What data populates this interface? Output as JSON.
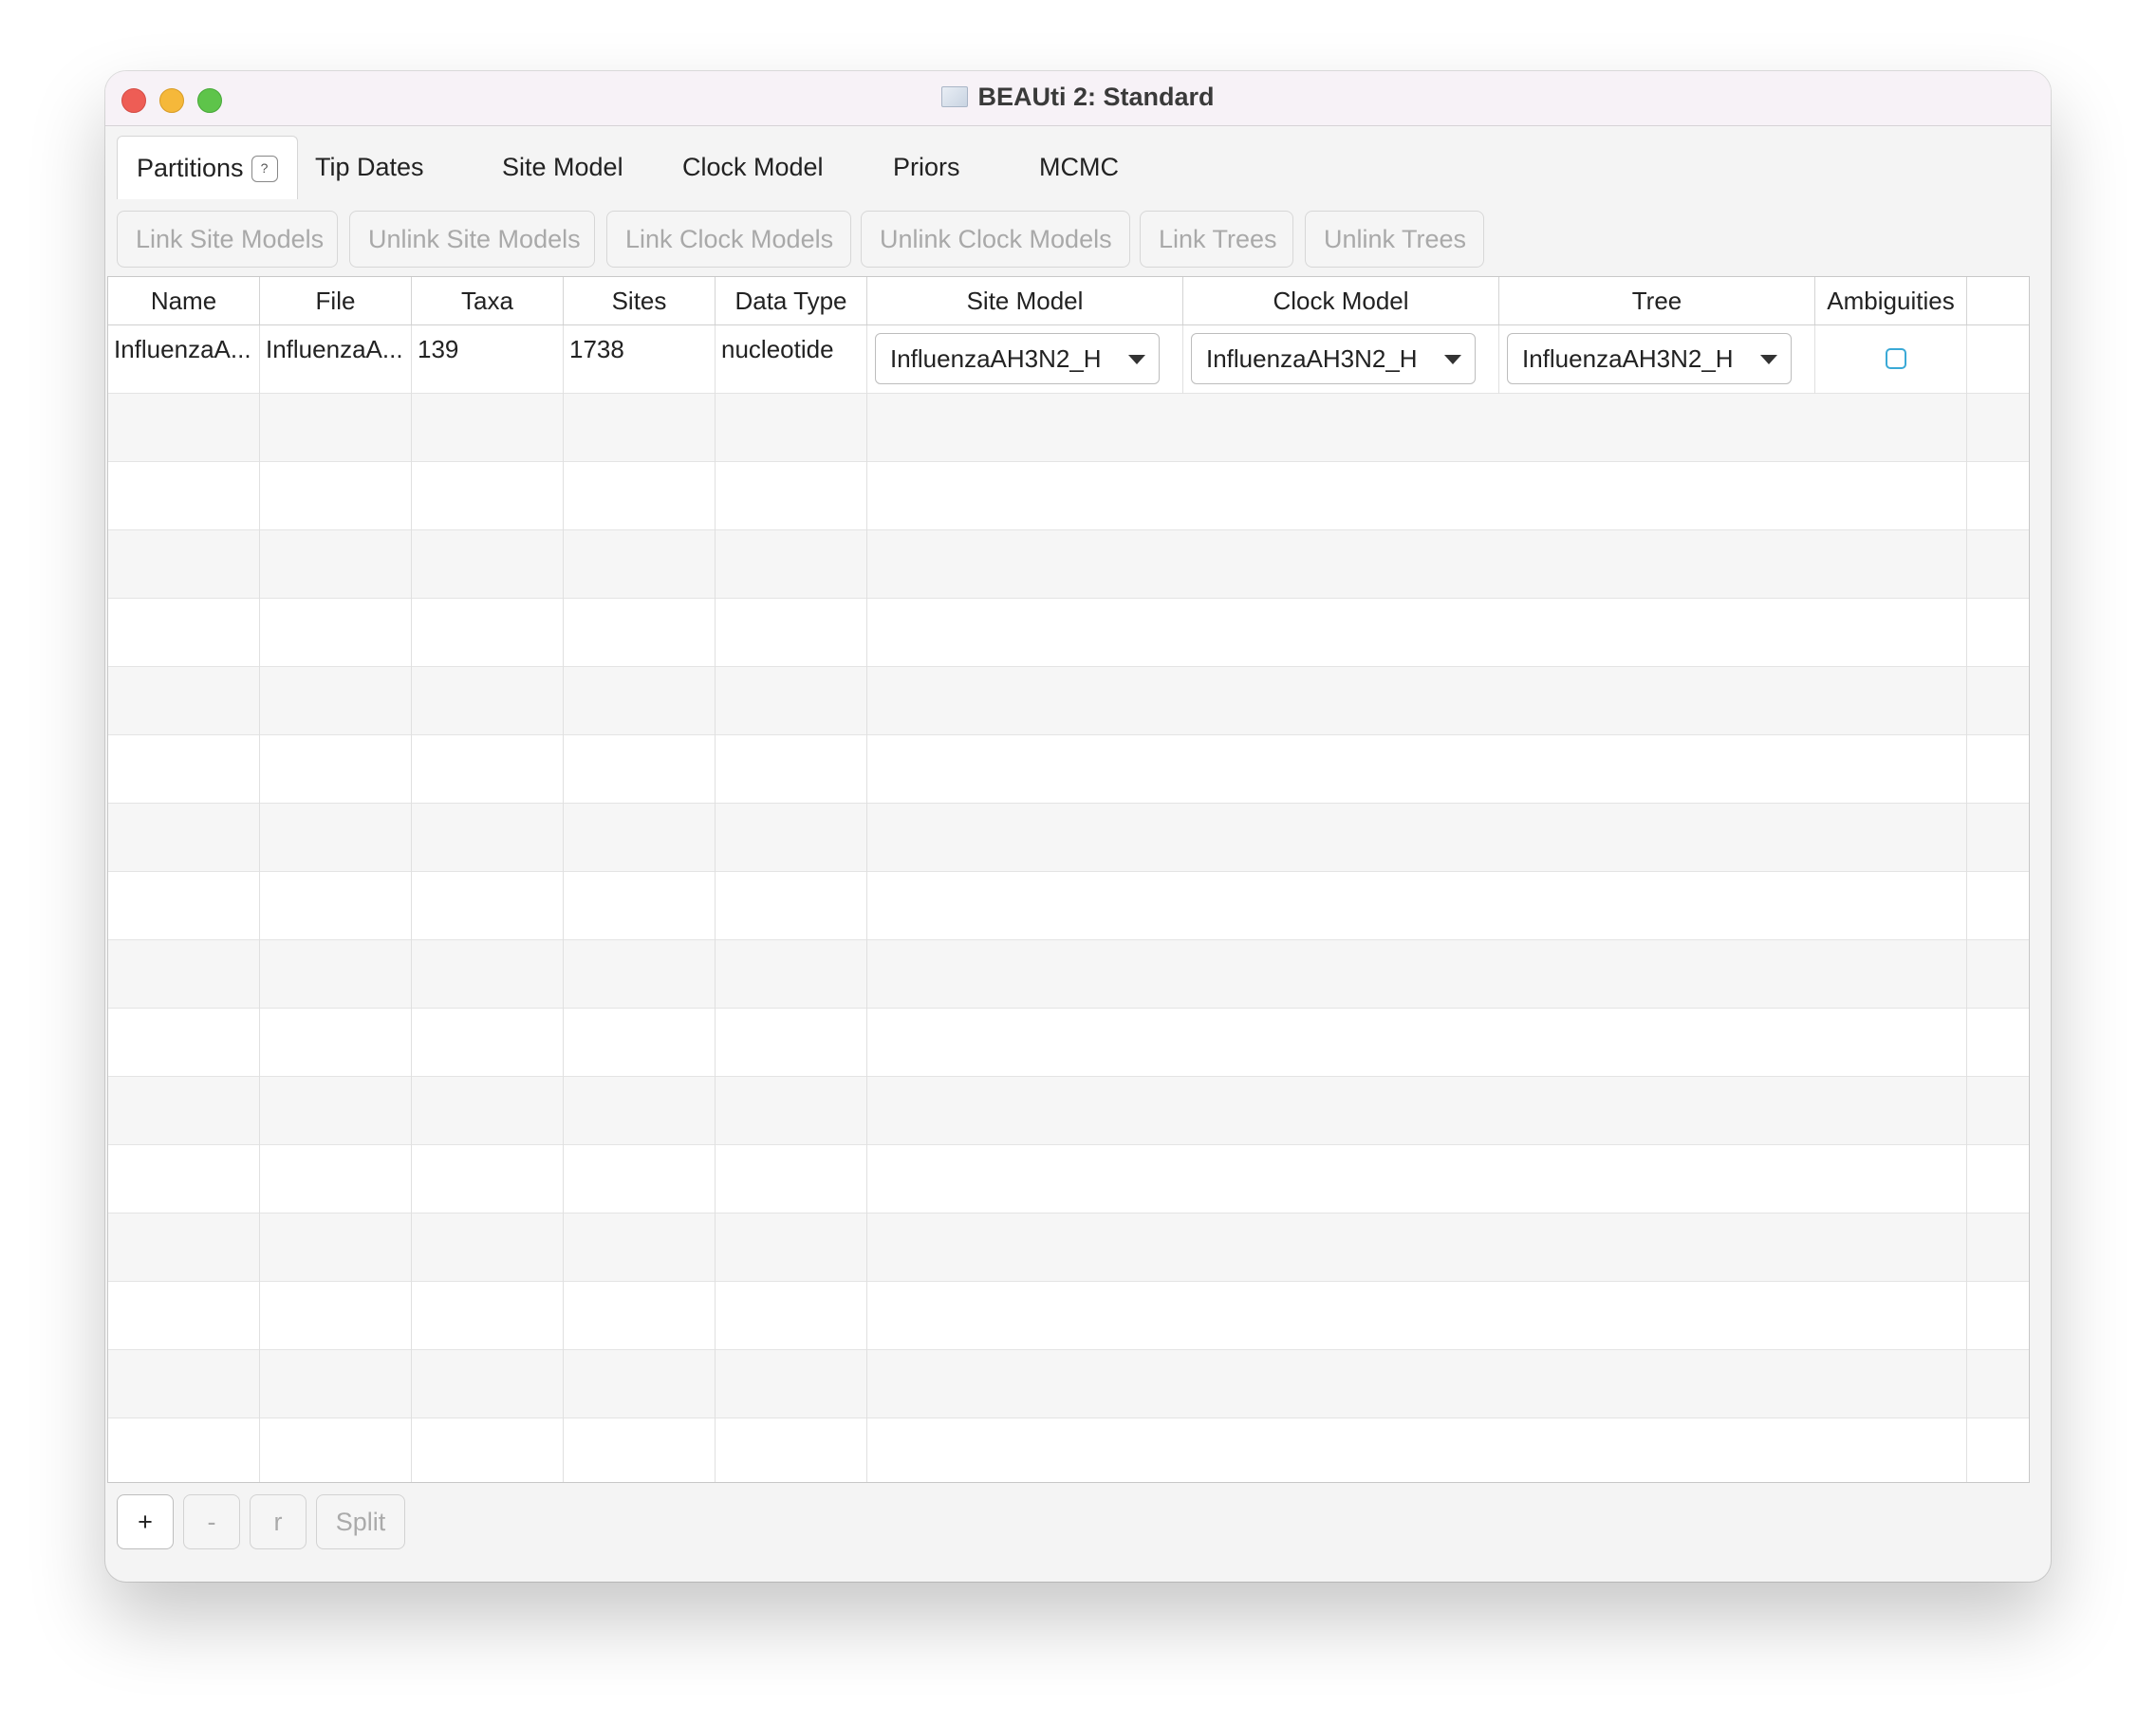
{
  "window": {
    "title": "BEAUti 2: Standard"
  },
  "tabs": [
    {
      "label": "Partitions",
      "active": true,
      "help": "?"
    },
    {
      "label": "Tip Dates"
    },
    {
      "label": "Site Model"
    },
    {
      "label": "Clock Model"
    },
    {
      "label": "Priors"
    },
    {
      "label": "MCMC"
    }
  ],
  "toolbar": {
    "link_site_models": "Link Site Models",
    "unlink_site_models": "Unlink Site Models",
    "link_clock_models": "Link Clock Models",
    "unlink_clock_models": "Unlink Clock Models",
    "link_trees": "Link Trees",
    "unlink_trees": "Unlink Trees"
  },
  "table": {
    "headers": [
      "Name",
      "File",
      "Taxa",
      "Sites",
      "Data Type",
      "Site Model",
      "Clock Model",
      "Tree",
      "Ambiguities"
    ],
    "rows": [
      {
        "name": "InfluenzaA...",
        "file": "InfluenzaA...",
        "taxa": "139",
        "sites": "1738",
        "data_type": "nucleotide",
        "site_model": "InfluenzaAH3N2_H",
        "clock_model": "InfluenzaAH3N2_H",
        "tree": "InfluenzaAH3N2_H",
        "ambiguities": false
      }
    ]
  },
  "bottom": {
    "add": "+",
    "remove": "-",
    "r": "r",
    "split": "Split"
  }
}
